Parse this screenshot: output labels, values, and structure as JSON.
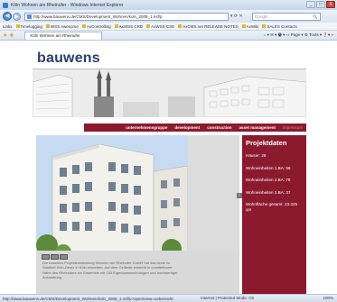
{
  "window": {
    "title": "Köln Wohnen am Rheinufer - Windows Internet Explorer",
    "buttons": {
      "minimize": "_",
      "maximize": "□",
      "close": "X"
    }
  },
  "toolbar": {
    "back": "◀",
    "forward": "▶",
    "url": "http://www.bauwens.de/CMS/Development_Wohnen/koln_2008_1.nsf/p",
    "url_controls": "▾ ⟳ ✕",
    "search_placeholder": "Google",
    "search_icon": "🔍"
  },
  "links_bar": {
    "label": "Links",
    "items": [
      "Timelogging",
      "WSS Awesome",
      "AxControlling",
      "AxWSS CRD",
      "AxWSS CSE",
      "AxCMS.net RELEASE NOTES",
      "AxWiki",
      "SALES Contacts"
    ]
  },
  "tabs": {
    "active": "Köln Wohnen am Rheinufer",
    "commands": "⌂ ▾  ✉ ▾  🖶 ▾  ⇨ Page ▾  ⚙ Tools ▾  ❓▾  »"
  },
  "site": {
    "logo": "bauwens",
    "nav": [
      "unternehmensgruppe",
      "development",
      "construction",
      "asset management",
      "impressum"
    ],
    "nav_active": 4,
    "body_text": "Die bauwens Projektentwicklung Wohnen am Rheinufer GmbH hat das Areal im Stadtteil Köln-Deutz in Köln erworben. Auf dem Gelände entsteht in unmittelbarer Nähe des Rheinufers ein Ensemble mit 103 Eigentumswohnungen und hochwertiger Ausstattung."
  },
  "project": {
    "heading": "Projektdaten",
    "items": [
      "Häuser: 26",
      "Wohneinheiten 1.BA: 58",
      "Wohneinheiten 2.BA: 78",
      "Wohneinheiten 3.BA: 37",
      "Wohnfläche gesamt: 23.325 qm"
    ]
  },
  "statusbar": {
    "url": "http://www.bauwens.de/CMS/Development_Wohnen/koln_2008_1.nsf/p?open/view=uebersicht",
    "zone": "Internet | Protected Mode: On",
    "zoom": "100%"
  },
  "colors": {
    "brand_red": "#8c1a2e",
    "logo_blue": "#2c3e6b"
  }
}
